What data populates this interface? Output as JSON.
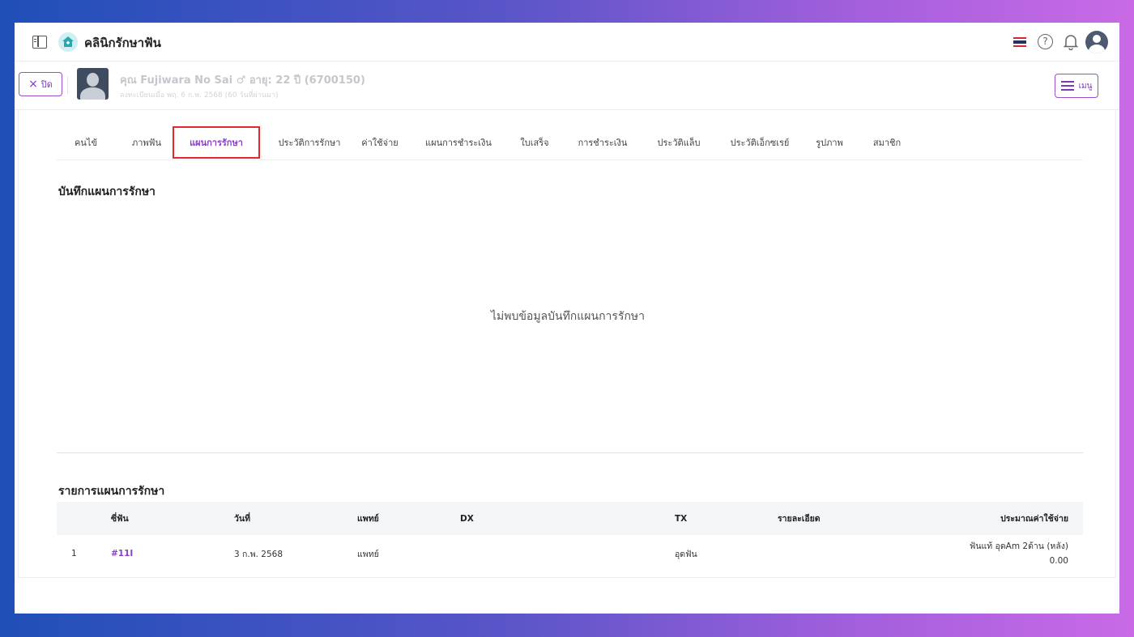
{
  "app": {
    "title": "คลินิกรักษาฟัน"
  },
  "patient": {
    "close_label": "ปิด",
    "name_line": "คุณ Fujiwara No Sai",
    "age_line": "อายุ: 22 ปี",
    "hn": "(6700150)",
    "sub_line": "ลงทะเบียนเมื่อ พฤ. 6 ก.พ. 2568 (60 วันที่ผ่านมา)",
    "menu_label": "เมนู"
  },
  "tabs": [
    {
      "label": "คนไข้"
    },
    {
      "label": "ภาพฟัน"
    },
    {
      "label": "แผนการรักษา"
    },
    {
      "label": "ประวัติการรักษา"
    },
    {
      "label": "ค่าใช้จ่าย"
    },
    {
      "label": "แผนการชำระเงิน"
    },
    {
      "label": "ใบเสร็จ"
    },
    {
      "label": "การชำระเงิน"
    },
    {
      "label": "ประวัติแล็บ"
    },
    {
      "label": "ประวัติเอ็กซเรย์"
    },
    {
      "label": "รูปภาพ"
    },
    {
      "label": "สมาชิก"
    }
  ],
  "active_tab": "แผนการรักษา",
  "notes": {
    "title": "บันทึกแผนการรักษา",
    "empty": "ไม่พบข้อมูลบันทึกแผนการรักษา"
  },
  "plan_list": {
    "title": "รายการแผนการรักษา",
    "headers": {
      "tooth": "ซี่ฟัน",
      "date": "วันที่",
      "doctor": "แพทย์",
      "dx": "DX",
      "tx": "TX",
      "detail": "รายละเอียด",
      "cost": "ประมาณค่าใช้จ่าย"
    },
    "rows": [
      {
        "no": "1",
        "tooth": "#11I",
        "date": "3 ก.พ. 2568",
        "doctor": "แพทย์",
        "dx": "",
        "tx": "อุดฟัน",
        "detail": "",
        "cost_desc": "ฟันแท้ อุดAm 2ด้าน (หลัง)",
        "cost_value": "0.00"
      }
    ]
  },
  "colors": {
    "accent": "#8b3fc9",
    "highlight_box": "#e0282e"
  }
}
